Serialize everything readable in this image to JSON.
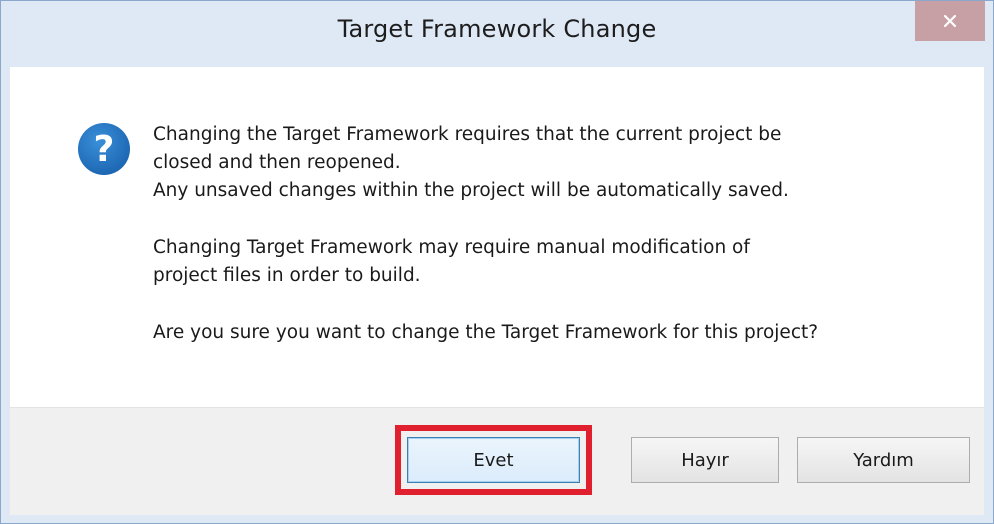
{
  "window": {
    "title": "Target Framework Change"
  },
  "icons": {
    "close": "close-icon",
    "question": "question-icon"
  },
  "message": {
    "line1": "Changing the Target Framework requires that the current project be",
    "line2": "closed and then reopened.",
    "line3": "Any unsaved changes within the project will be automatically saved.",
    "line4": "Changing Target Framework may require manual modification of",
    "line5": "project files in order to build.",
    "line6": "Are you sure you want to change the Target Framework for this project?"
  },
  "buttons": {
    "yes": "Evet",
    "no": "Hayır",
    "help": "Yardım"
  },
  "colors": {
    "highlight": "#e0202e",
    "icon_blue": "#1f73c4",
    "close_bg": "#c7a0a6"
  }
}
